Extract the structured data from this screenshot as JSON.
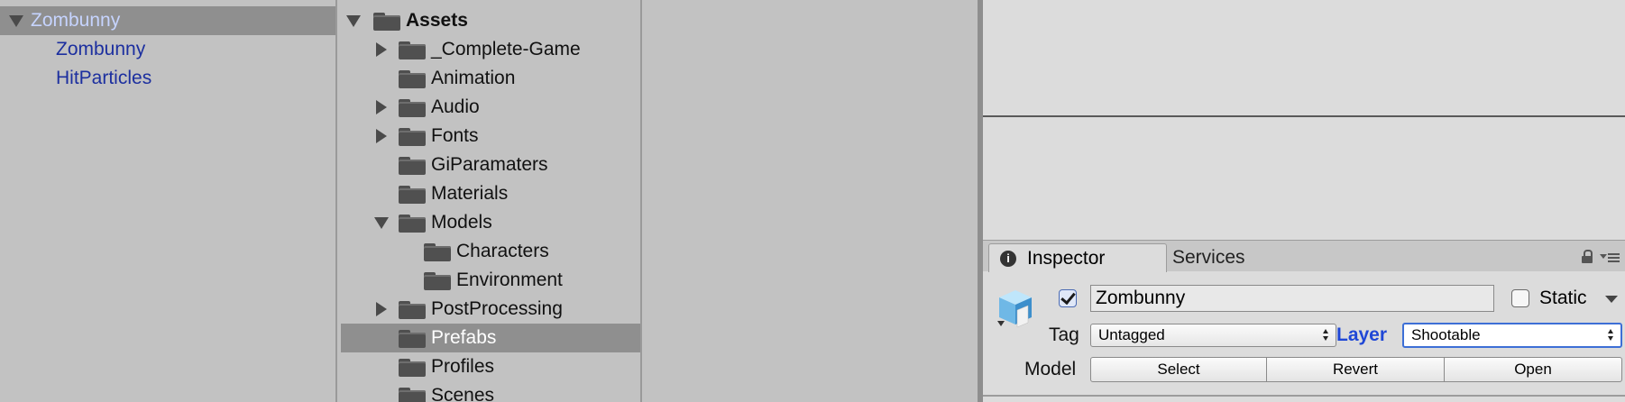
{
  "hierarchy": {
    "items": [
      {
        "label": "Zombunny",
        "selected": true,
        "expanded": true
      },
      {
        "label": "Zombunny"
      },
      {
        "label": "HitParticles"
      }
    ]
  },
  "project": {
    "folders": [
      {
        "label": "Assets",
        "expander": "down"
      },
      {
        "label": "_Complete-Game",
        "expander": "right"
      },
      {
        "label": "Animation",
        "expander": "none"
      },
      {
        "label": "Audio",
        "expander": "right"
      },
      {
        "label": "Fonts",
        "expander": "right"
      },
      {
        "label": "GiParamaters",
        "expander": "none"
      },
      {
        "label": "Materials",
        "expander": "none"
      },
      {
        "label": "Models",
        "expander": "down"
      },
      {
        "label": "Characters",
        "expander": "none"
      },
      {
        "label": "Environment",
        "expander": "none"
      },
      {
        "label": "PostProcessing",
        "expander": "right"
      },
      {
        "label": "Prefabs",
        "expander": "none",
        "selected": true
      },
      {
        "label": "Profiles",
        "expander": "none"
      },
      {
        "label": "Scenes",
        "expander": "none"
      }
    ]
  },
  "inspector": {
    "tabs": [
      {
        "label": "Inspector",
        "active": true
      },
      {
        "label": "Services"
      }
    ],
    "object": {
      "active": true,
      "name": "Zombunny",
      "static_label": "Static",
      "static": false
    },
    "tag_label": "Tag",
    "tag_value": "Untagged",
    "layer_label": "Layer",
    "layer_value": "Shootable",
    "model_label": "Model",
    "buttons": {
      "select": "Select",
      "revert": "Revert",
      "open": "Open"
    }
  },
  "colors": {
    "hierarchy_text": "#1c2f9f",
    "selection": "#8f8f8f",
    "layer_accent": "#1f47d6"
  }
}
